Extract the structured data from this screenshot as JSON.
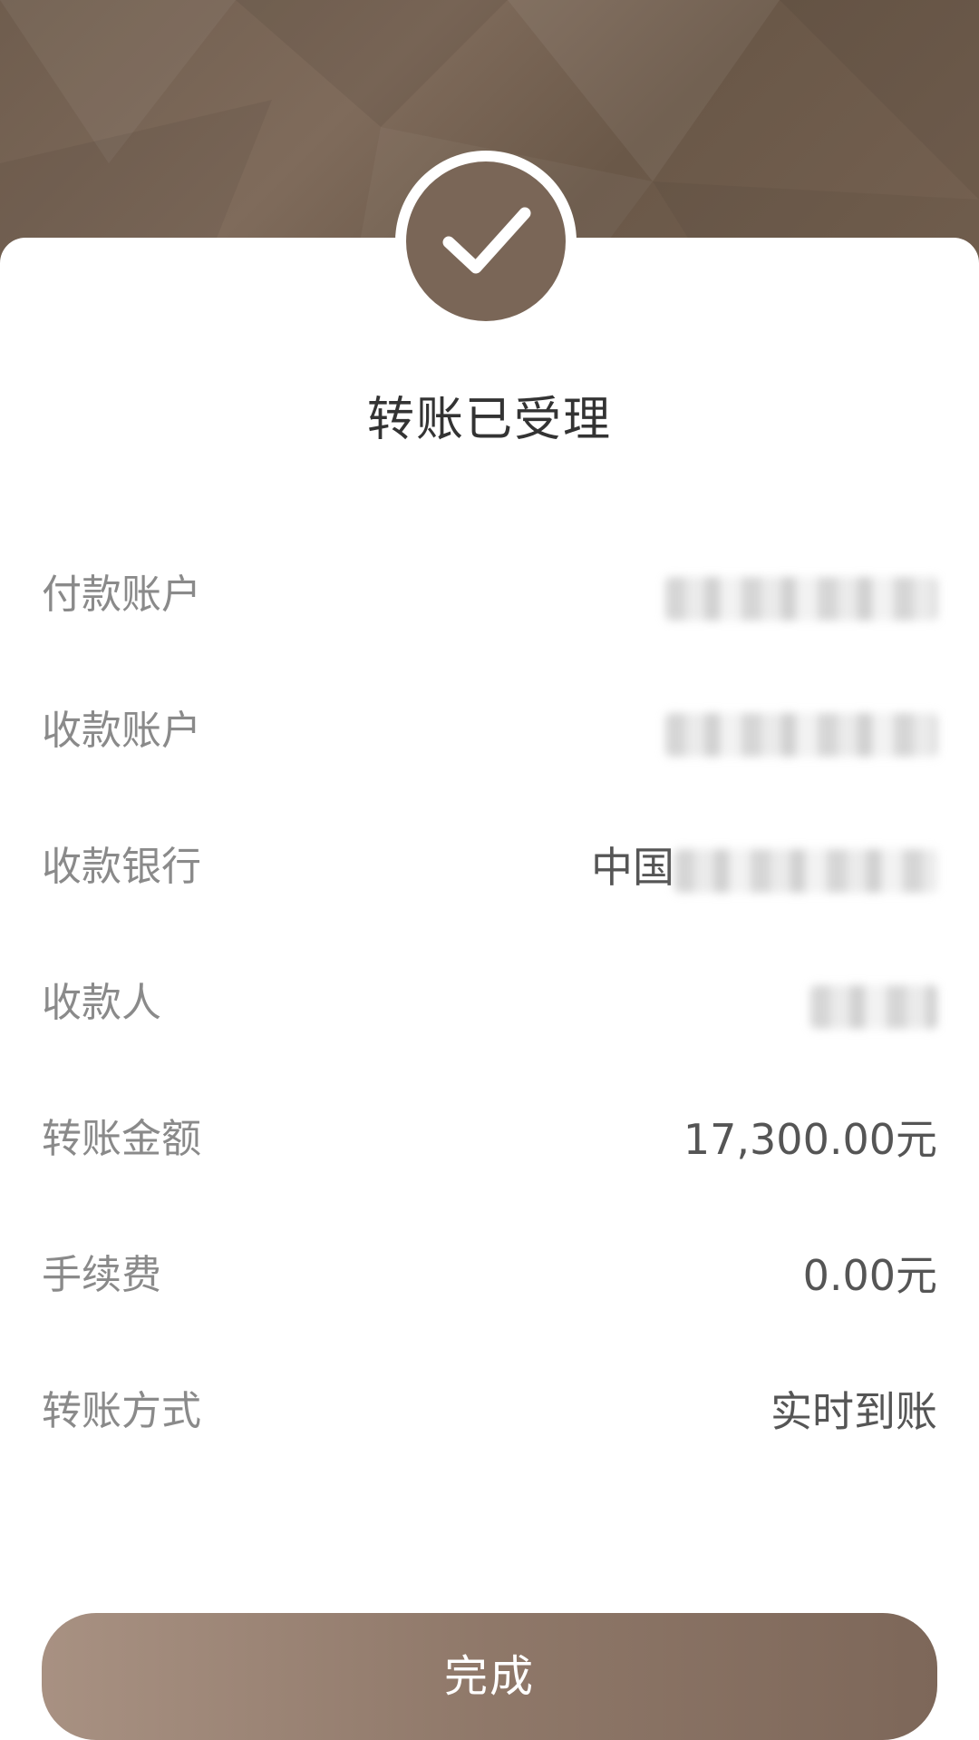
{
  "status": {
    "title": "转账已受理"
  },
  "details": [
    {
      "label": "付款账户",
      "value": ""
    },
    {
      "label": "收款账户",
      "value": ""
    },
    {
      "label": "收款银行",
      "value": "中国"
    },
    {
      "label": "收款人",
      "value": ""
    },
    {
      "label": "转账金额",
      "value": "17,300.00元"
    },
    {
      "label": "手续费",
      "value": "0.00元"
    },
    {
      "label": "转账方式",
      "value": "实时到账"
    }
  ],
  "actions": {
    "done_label": "完成"
  },
  "colors": {
    "accent": "#7a6657",
    "label": "#8a8a8a",
    "value": "#555555"
  },
  "icons": {
    "success": "checkmark-icon"
  }
}
